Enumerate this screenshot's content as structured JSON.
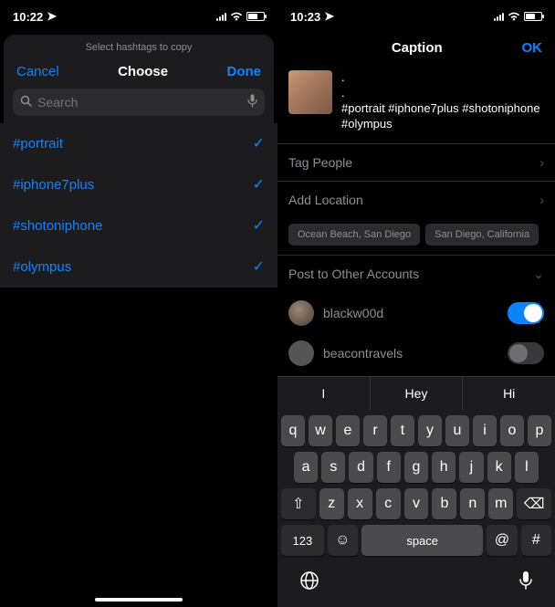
{
  "left": {
    "status_time": "10:22",
    "sheet_prompt": "Select hashtags to copy",
    "cancel": "Cancel",
    "choose": "Choose",
    "done": "Done",
    "search_placeholder": "Search",
    "hashtags": [
      {
        "text": "#portrait",
        "checked": true
      },
      {
        "text": "#iphone7plus",
        "checked": true
      },
      {
        "text": "#shotoniphone",
        "checked": true
      },
      {
        "text": "#olympus",
        "checked": true
      }
    ]
  },
  "right": {
    "status_time": "10:23",
    "title": "Caption",
    "ok": "OK",
    "caption_line1": ".",
    "caption_line2": ".",
    "caption_line3": "#portrait #iphone7plus #shotoniphone #olympus",
    "tag_people": "Tag People",
    "add_location": "Add Location",
    "chips": [
      "Ocean Beach, San Diego",
      "San Diego, California"
    ],
    "post_to": "Post to Other Accounts",
    "accounts": [
      {
        "name": "blackw00d",
        "on": true
      },
      {
        "name": "beacontravels",
        "on": false
      }
    ],
    "suggestions": [
      "I",
      "Hey",
      "Hi"
    ],
    "rows": [
      [
        "q",
        "w",
        "e",
        "r",
        "t",
        "y",
        "u",
        "i",
        "o",
        "p"
      ],
      [
        "a",
        "s",
        "d",
        "f",
        "g",
        "h",
        "j",
        "k",
        "l"
      ],
      [
        "z",
        "x",
        "c",
        "v",
        "b",
        "n",
        "m"
      ]
    ],
    "key_123": "123",
    "key_space": "space",
    "key_at": "@",
    "key_hash": "#"
  }
}
